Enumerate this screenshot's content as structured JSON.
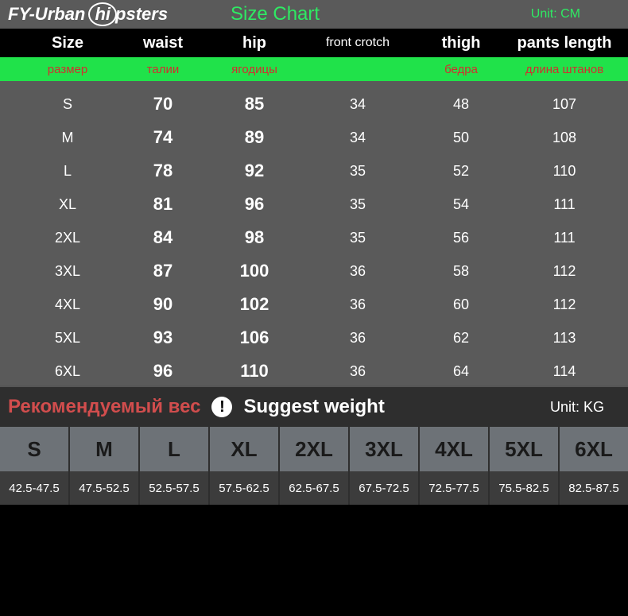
{
  "brand": {
    "prefix": "FY-Urban ",
    "circle": "hi",
    "suffix": "psters"
  },
  "title": "Size Chart",
  "unit_cm": "Unit: CM",
  "headers_en": {
    "size": "Size",
    "waist": "waist",
    "hip": "hip",
    "front_crotch": "front crotch",
    "thigh": "thigh",
    "pants_length": "pants length"
  },
  "headers_ru": {
    "size": "размер",
    "waist": "талии",
    "hip": "ягодицы",
    "front_crotch": "",
    "thigh": "бедра",
    "pants_length": "длина штанов"
  },
  "rows": [
    {
      "size": "S",
      "waist": "70",
      "hip": "85",
      "fc": "34",
      "thigh": "48",
      "pl": "107"
    },
    {
      "size": "M",
      "waist": "74",
      "hip": "89",
      "fc": "34",
      "thigh": "50",
      "pl": "108"
    },
    {
      "size": "L",
      "waist": "78",
      "hip": "92",
      "fc": "35",
      "thigh": "52",
      "pl": "110"
    },
    {
      "size": "XL",
      "waist": "81",
      "hip": "96",
      "fc": "35",
      "thigh": "54",
      "pl": "111"
    },
    {
      "size": "2XL",
      "waist": "84",
      "hip": "98",
      "fc": "35",
      "thigh": "56",
      "pl": "111"
    },
    {
      "size": "3XL",
      "waist": "87",
      "hip": "100",
      "fc": "36",
      "thigh": "58",
      "pl": "112"
    },
    {
      "size": "4XL",
      "waist": "90",
      "hip": "102",
      "fc": "36",
      "thigh": "60",
      "pl": "112"
    },
    {
      "size": "5XL",
      "waist": "93",
      "hip": "106",
      "fc": "36",
      "thigh": "62",
      "pl": "113"
    },
    {
      "size": "6XL",
      "waist": "96",
      "hip": "110",
      "fc": "36",
      "thigh": "64",
      "pl": "114"
    }
  ],
  "weight": {
    "title_ru": "Рекомендуемый вес",
    "title_en": "Suggest weight",
    "unit": "Unit: KG",
    "cols": [
      {
        "size": "S",
        "val": "42.5-47.5"
      },
      {
        "size": "M",
        "val": "47.5-52.5"
      },
      {
        "size": "L",
        "val": "52.5-57.5"
      },
      {
        "size": "XL",
        "val": "57.5-62.5"
      },
      {
        "size": "2XL",
        "val": "62.5-67.5"
      },
      {
        "size": "3XL",
        "val": "67.5-72.5"
      },
      {
        "size": "4XL",
        "val": "72.5-77.5"
      },
      {
        "size": "5XL",
        "val": "75.5-82.5"
      },
      {
        "size": "6XL",
        "val": "82.5-87.5"
      }
    ]
  },
  "chart_data": {
    "type": "table",
    "title": "Size Chart (CM)",
    "columns": [
      "Size",
      "waist",
      "hip",
      "front crotch",
      "thigh",
      "pants length"
    ],
    "rows": [
      [
        "S",
        70,
        85,
        34,
        48,
        107
      ],
      [
        "M",
        74,
        89,
        34,
        50,
        108
      ],
      [
        "L",
        78,
        92,
        35,
        52,
        110
      ],
      [
        "XL",
        81,
        96,
        35,
        54,
        111
      ],
      [
        "2XL",
        84,
        98,
        35,
        56,
        111
      ],
      [
        "3XL",
        87,
        100,
        36,
        58,
        112
      ],
      [
        "4XL",
        90,
        102,
        36,
        60,
        112
      ],
      [
        "5XL",
        93,
        106,
        36,
        62,
        113
      ],
      [
        "6XL",
        96,
        110,
        36,
        64,
        114
      ]
    ]
  }
}
